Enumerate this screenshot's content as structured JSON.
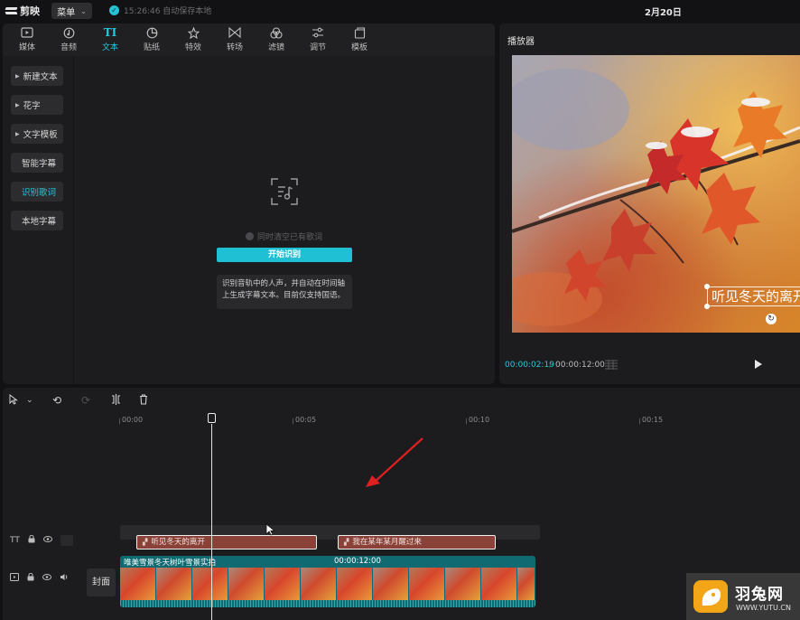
{
  "app": {
    "logo_text": "剪映",
    "menu_label": "菜单",
    "save_status": "15:26:46 自动保存本地",
    "date": "2月20日"
  },
  "toolbar_tabs": [
    {
      "label": "媒体",
      "icon": "media-icon"
    },
    {
      "label": "音频",
      "icon": "audio-icon"
    },
    {
      "label": "文本",
      "icon": "text-icon",
      "active": true
    },
    {
      "label": "贴纸",
      "icon": "sticker-icon"
    },
    {
      "label": "特效",
      "icon": "effects-icon"
    },
    {
      "label": "转场",
      "icon": "transition-icon"
    },
    {
      "label": "滤镜",
      "icon": "filter-icon"
    },
    {
      "label": "调节",
      "icon": "adjust-icon"
    },
    {
      "label": "模板",
      "icon": "template-icon"
    }
  ],
  "sidebar": {
    "items": [
      {
        "label": "新建文本"
      },
      {
        "label": "花字"
      },
      {
        "label": "文字模板"
      },
      {
        "label": "智能字幕"
      },
      {
        "label": "识别歌词"
      },
      {
        "label": "本地字幕"
      }
    ]
  },
  "lyrics": {
    "clear_option": "同时清空已有歌词",
    "start_button": "开始识别",
    "description": "识别音轨中的人声，并自动在时间轴上生成字幕文本。目前仅支持国语。"
  },
  "player": {
    "title": "播放器",
    "subtitle_overlay": "听见冬天的离开",
    "current_time": "00:00:02:19",
    "separator": "/",
    "total_time": "00:00:12:00"
  },
  "timeline": {
    "ruler_labels": [
      "00:00",
      "00:05",
      "00:10",
      "00:15"
    ],
    "text_track_label": "TT",
    "text_clips": [
      "听见冬天的离开",
      "我在某年某月醒过来"
    ],
    "cover_label": "封面",
    "video_clip_title": "唯美雪景冬天树叶雪景实拍",
    "video_clip_duration": "00:00:12:00"
  },
  "watermark": {
    "name": "羽兔网",
    "url": "WWW.YUTU.CN"
  },
  "colors": {
    "accent": "#1fc0d4",
    "text_clip": "#8a4238",
    "video_clip": "#0f6a72",
    "annotation_arrow": "#e02020"
  }
}
